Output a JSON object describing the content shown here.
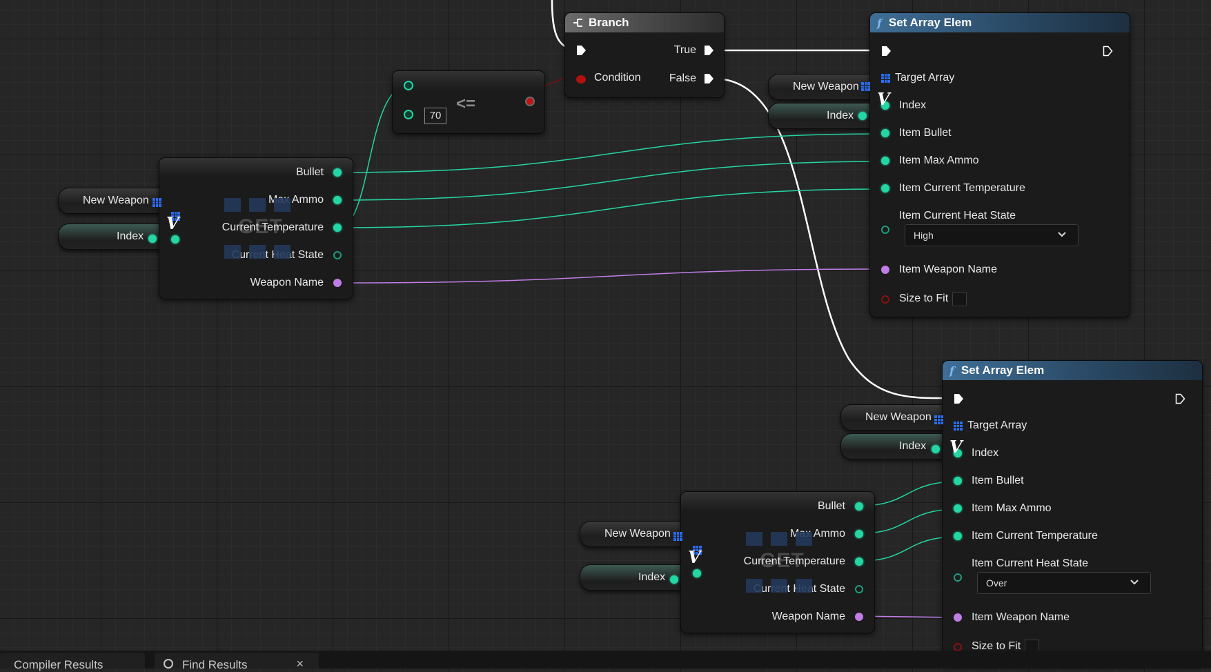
{
  "branch": {
    "title": "Branch",
    "true_label": "True",
    "false_label": "False",
    "condition_label": "Condition"
  },
  "compare": {
    "operator": "<=",
    "value": "70"
  },
  "get_node_top": {
    "watermark": "GET",
    "pins": [
      "Bullet",
      "Max Ammo",
      "Current Temperature",
      "Current Heat State",
      "Weapon Name"
    ]
  },
  "get_node_bottom": {
    "watermark": "GET",
    "pins": [
      "Bullet",
      "Max Ammo",
      "Current Temperature",
      "Current Heat State",
      "Weapon Name"
    ]
  },
  "variables": {
    "new_weapon": "New Weapon",
    "index": "Index"
  },
  "set_array_top": {
    "title": "Set Array Elem",
    "pins": [
      "Target Array",
      "Index",
      "Item Bullet",
      "Item Max Ammo",
      "Item Current Temperature",
      "Item Current Heat State",
      "Item Weapon Name",
      "Size to Fit"
    ],
    "heat_state": "High"
  },
  "set_array_bottom": {
    "title": "Set Array Elem",
    "pins": [
      "Target Array",
      "Index",
      "Item Bullet",
      "Item Max Ammo",
      "Item Current Temperature",
      "Item Current Heat State",
      "Item Weapon Name",
      "Size to Fit"
    ],
    "heat_state": "Over"
  },
  "tabs": {
    "compiler_results": "Compiler Results",
    "find_results": "Find Results",
    "close": "×"
  },
  "colors": {
    "float_pin": "#24d6a3",
    "string_pin": "#c07de6",
    "bool_pin": "#b31010",
    "exec_wire": "#ffffff",
    "function_header": "#3f6e96"
  },
  "icons": [
    "branch-icon",
    "function-icon",
    "array-grid-icon",
    "exec-pin-icon",
    "chevron-down-icon",
    "search-icon",
    "close-icon"
  ]
}
